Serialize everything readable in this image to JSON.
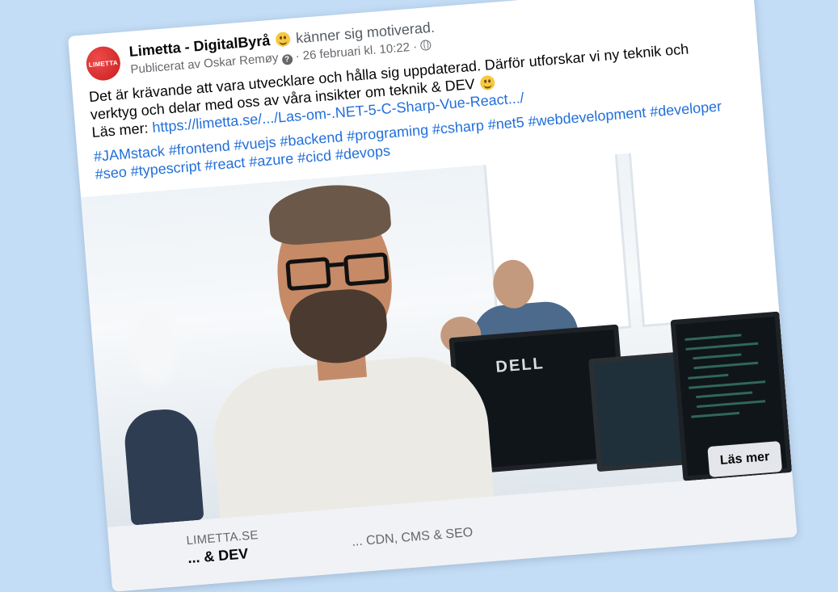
{
  "post": {
    "page_name": "Limetta - DigitalByrå",
    "activity": "känner sig motiverad.",
    "published_by": "Publicerat av Oskar Remøy",
    "date": "· 26 februari kl. 10:22 ·",
    "logo_text": "LIMETTA"
  },
  "body": {
    "text": "Det är krävande att vara utvecklare och hålla sig uppdaterad. Därför utforskar vi ny teknik och verktyg och delar med oss av våra insikter om teknik & DEV",
    "read_more_prefix": "Läs mer:",
    "link_text": "https://limetta.se/.../Las-om-.NET-5-C-Sharp-Vue-React.../",
    "hashtags": "#JAMstack #frontend #vuejs #backend #programing #csharp #net5 #webdevelopment #developer #seo #typescript #react #azure #cicd #devops"
  },
  "photo": {
    "monitor_brand": "DELL"
  },
  "link_preview": {
    "domain": "LIMETTA.SE",
    "title": "... & DEV",
    "description": "... CDN, CMS & SEO",
    "button_label": "Läs mer"
  },
  "colors": {
    "background": "#c4ddf6",
    "link": "#216fdb",
    "logo": "#d42a2a"
  }
}
